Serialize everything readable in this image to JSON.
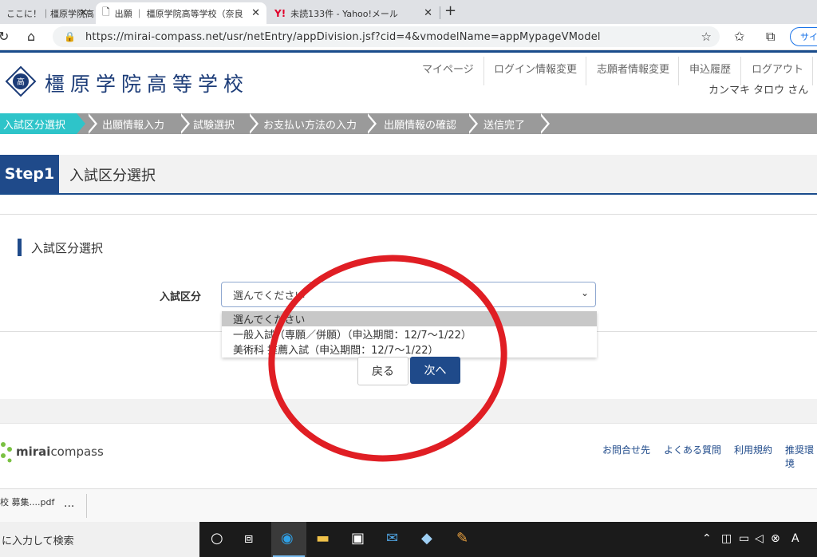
{
  "browser": {
    "tabs": [
      {
        "title": "ここに！｜橿原学院高",
        "active": false
      },
      {
        "title": "出願 ｜ 橿原学院高等学校（奈良",
        "active": true
      },
      {
        "title": "未読133件 - Yahoo!メール",
        "active": false
      }
    ],
    "new_tab": "+",
    "url": "https://mirai-compass.net/usr/netEntry/appDivision.jsf?cid=4&vmodelName=appMypageVModel",
    "signin_label": "サイ"
  },
  "site": {
    "school_name": "橿原学院高等学校",
    "nav": [
      "マイページ",
      "ログイン情報変更",
      "志願者情報変更",
      "申込履歴",
      "ログアウト"
    ],
    "user": "カンマキ タロウ さん"
  },
  "steps": [
    "入試区分選択",
    "出願情報入力",
    "試験選択",
    "お支払い方法の入力",
    "出願情報の確認",
    "送信完了"
  ],
  "step_heading": {
    "badge": "Step1",
    "title": "入試区分選択"
  },
  "form": {
    "section_title": "入試区分選択",
    "field_label": "入試区分",
    "select_value": "選んでください",
    "options": [
      "選んでください",
      "一般入試（専願／併願）（申込期間：12/7～1/22）",
      "美術科 推薦入試（申込期間：12/7～1/22）"
    ]
  },
  "buttons": {
    "back": "戻る",
    "next": "次へ"
  },
  "footer": {
    "logo_bold": "mirai",
    "logo_light": "compass",
    "links": [
      "お問合せ先",
      "よくある質問",
      "利用規約",
      "推奨環境"
    ]
  },
  "download": {
    "file": "校 募集....pdf",
    "more": "..."
  },
  "taskbar": {
    "search_placeholder": "に入力して検索"
  },
  "colors": {
    "accent": "#1f4a8a",
    "active_step": "#2ec4c9",
    "annotation": "#e01e24"
  }
}
